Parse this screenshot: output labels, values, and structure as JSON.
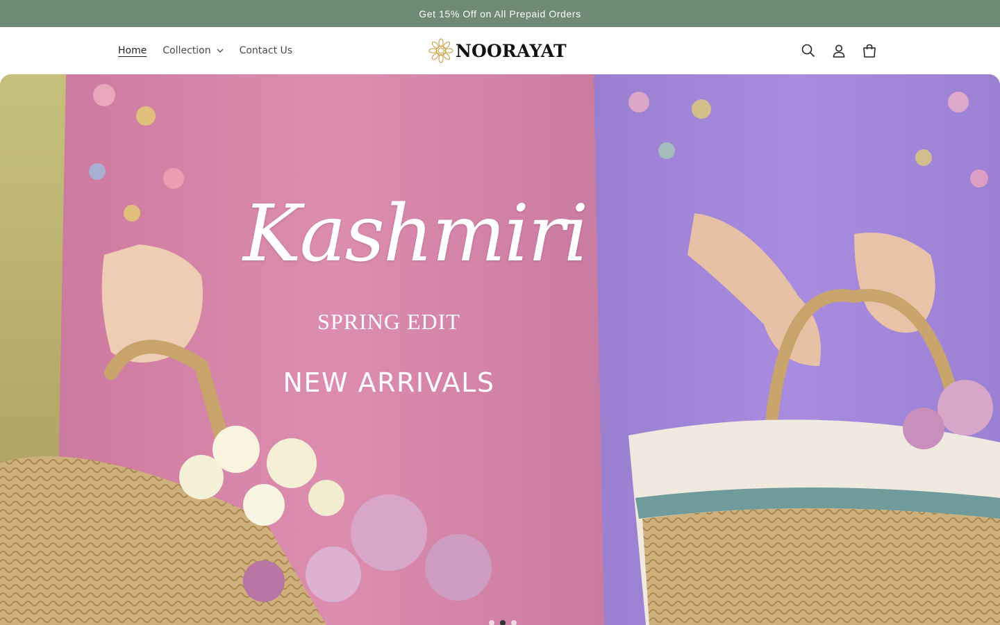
{
  "announcement": {
    "text": "Get 15% Off on All Prepaid Orders"
  },
  "nav": {
    "items": [
      {
        "label": "Home",
        "active": true
      },
      {
        "label": "Collection",
        "has_dropdown": true
      },
      {
        "label": "Contact Us"
      }
    ]
  },
  "brand": {
    "name": "NOORAYAT",
    "logo_icon": "flower-mandala-icon"
  },
  "header_icons": [
    "search-icon",
    "account-icon",
    "cart-icon"
  ],
  "hero": {
    "title": "Kashmiri",
    "subtitle": "SPRING EDIT",
    "tagline": "NEW ARRIVALS",
    "slides_total": 3,
    "active_slide": 2
  },
  "colors": {
    "announcement_bg": "#6f8a72",
    "pink_dress": "#d786a8",
    "lilac_dress": "#a488d8"
  }
}
